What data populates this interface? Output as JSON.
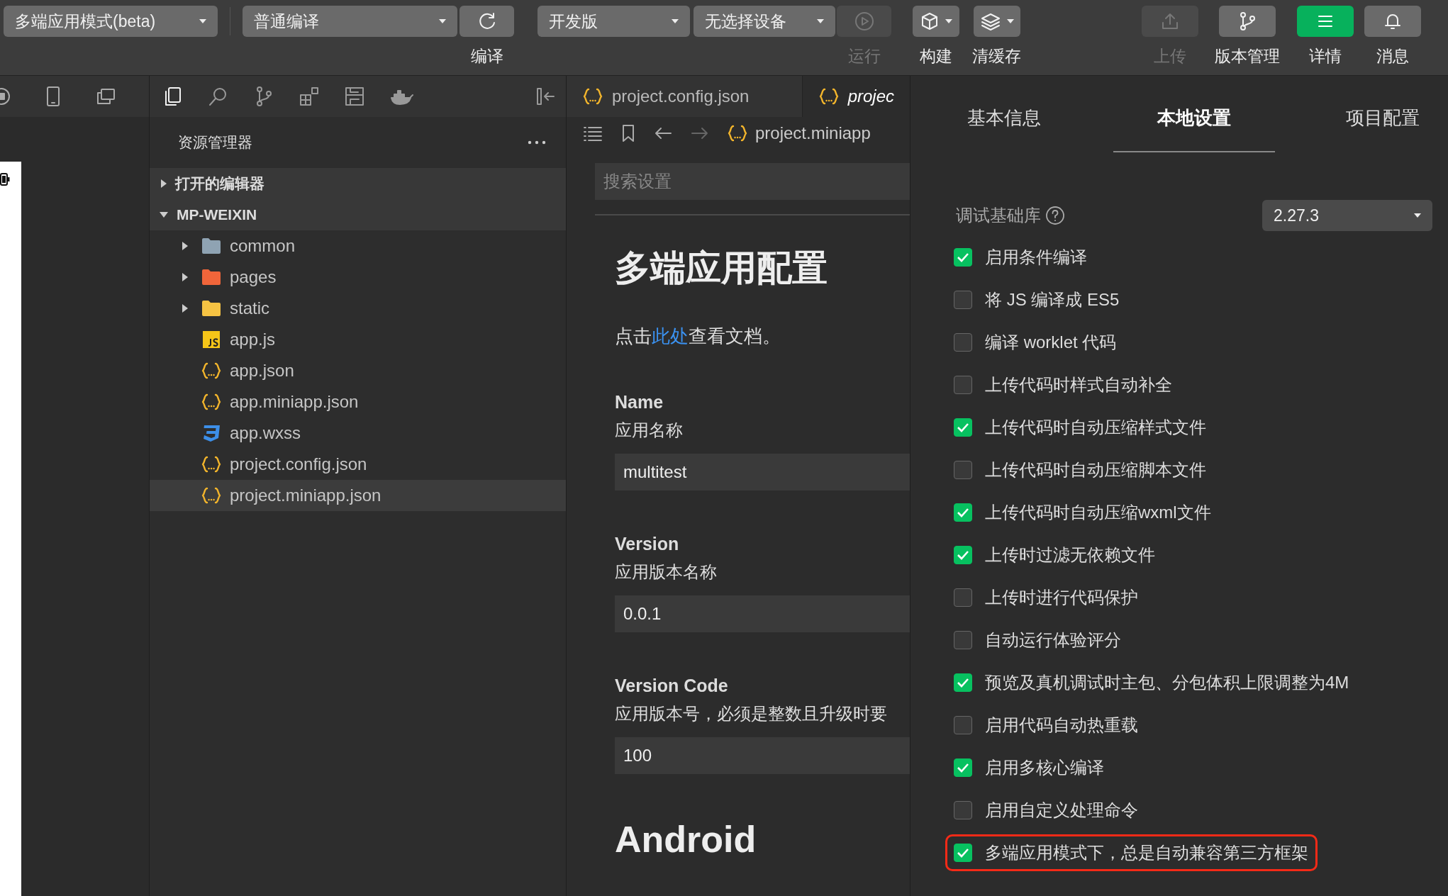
{
  "toolbar": {
    "mode_select": {
      "value": "多端应用模式(beta)"
    },
    "compile_select": {
      "value": "普通编译"
    },
    "compile_button": {
      "label": "编译",
      "disabled": false
    },
    "version_select": {
      "value": "开发版"
    },
    "device_select": {
      "value": "无选择设备"
    },
    "run_button": {
      "label": "运行",
      "disabled": true
    },
    "actions": [
      {
        "label": "构建",
        "has_menu": true,
        "disabled": false,
        "active": false
      },
      {
        "label": "清缓存",
        "has_menu": true,
        "disabled": false,
        "active": false
      },
      {
        "label": "上传",
        "has_menu": false,
        "disabled": true,
        "active": false
      },
      {
        "label": "版本管理",
        "has_menu": false,
        "disabled": false,
        "active": false
      },
      {
        "label": "详情",
        "has_menu": false,
        "disabled": false,
        "active": true
      },
      {
        "label": "消息",
        "has_menu": false,
        "disabled": false,
        "active": false
      }
    ]
  },
  "explorer": {
    "activity_items": [
      {
        "selected": true
      },
      {
        "selected": false
      },
      {
        "selected": false
      },
      {
        "selected": false
      },
      {
        "selected": false
      },
      {
        "selected": false
      }
    ],
    "title": "资源管理器",
    "sections": [
      {
        "label": "打开的编辑器",
        "expanded": false
      },
      {
        "label": "MP-WEIXIN",
        "expanded": true,
        "children": [
          {
            "name": "common",
            "kind": "folder",
            "color": "#8fa3b3",
            "expanded": false,
            "selected": false
          },
          {
            "name": "pages",
            "kind": "folder",
            "color": "#f0653a",
            "expanded": false,
            "selected": false
          },
          {
            "name": "static",
            "kind": "folder",
            "color": "#f6c343",
            "expanded": false,
            "selected": false
          },
          {
            "name": "app.js",
            "kind": "js",
            "selected": false
          },
          {
            "name": "app.json",
            "kind": "json",
            "selected": false
          },
          {
            "name": "app.miniapp.json",
            "kind": "json",
            "selected": false
          },
          {
            "name": "app.wxss",
            "kind": "css",
            "selected": false
          },
          {
            "name": "project.config.json",
            "kind": "json",
            "selected": false
          },
          {
            "name": "project.miniapp.json",
            "kind": "json",
            "selected": true
          }
        ]
      }
    ]
  },
  "editor": {
    "tabs": [
      {
        "label": "project.config.json",
        "selected": false
      },
      {
        "label": "projec",
        "selected": true
      }
    ],
    "breadcrumb": "project.miniapp",
    "search": {
      "placeholder": "搜索设置"
    },
    "heading": "多端应用配置",
    "doc_text": {
      "before": "点击",
      "link": "此处",
      "after": "查看文档。"
    },
    "fields": [
      {
        "label": "Name",
        "description": "应用名称",
        "value": "multitest"
      },
      {
        "label": "Version",
        "description": "应用版本名称",
        "value": "0.0.1"
      },
      {
        "label": "Version Code",
        "description": "应用版本号，必须是整数且升级时要",
        "value": "100"
      }
    ],
    "subheading": "Android"
  },
  "settings": {
    "tabs": [
      {
        "label": "基本信息",
        "selected": false
      },
      {
        "label": "本地设置",
        "selected": true
      },
      {
        "label": "项目配置",
        "selected": false
      }
    ],
    "library": {
      "label": "调试基础库",
      "value": "2.27.3"
    },
    "options": [
      {
        "label": "启用条件编译",
        "checked": true,
        "highlighted": false
      },
      {
        "label": "将 JS 编译成 ES5",
        "checked": false,
        "highlighted": false
      },
      {
        "label": "编译 worklet 代码",
        "checked": false,
        "highlighted": false
      },
      {
        "label": "上传代码时样式自动补全",
        "checked": false,
        "highlighted": false
      },
      {
        "label": "上传代码时自动压缩样式文件",
        "checked": true,
        "highlighted": false
      },
      {
        "label": "上传代码时自动压缩脚本文件",
        "checked": false,
        "highlighted": false
      },
      {
        "label": "上传代码时自动压缩wxml文件",
        "checked": true,
        "highlighted": false
      },
      {
        "label": "上传时过滤无依赖文件",
        "checked": true,
        "highlighted": false
      },
      {
        "label": "上传时进行代码保护",
        "checked": false,
        "highlighted": false
      },
      {
        "label": "自动运行体验评分",
        "checked": false,
        "highlighted": false
      },
      {
        "label": "预览及真机调试时主包、分包体积上限调整为4M",
        "checked": true,
        "highlighted": false
      },
      {
        "label": "启用代码自动热重载",
        "checked": false,
        "highlighted": false
      },
      {
        "label": "启用多核心编译",
        "checked": true,
        "highlighted": false
      },
      {
        "label": "启用自定义处理命令",
        "checked": false,
        "highlighted": false
      },
      {
        "label": "多端应用模式下，总是自动兼容第三方框架",
        "checked": true,
        "highlighted": true
      }
    ]
  }
}
